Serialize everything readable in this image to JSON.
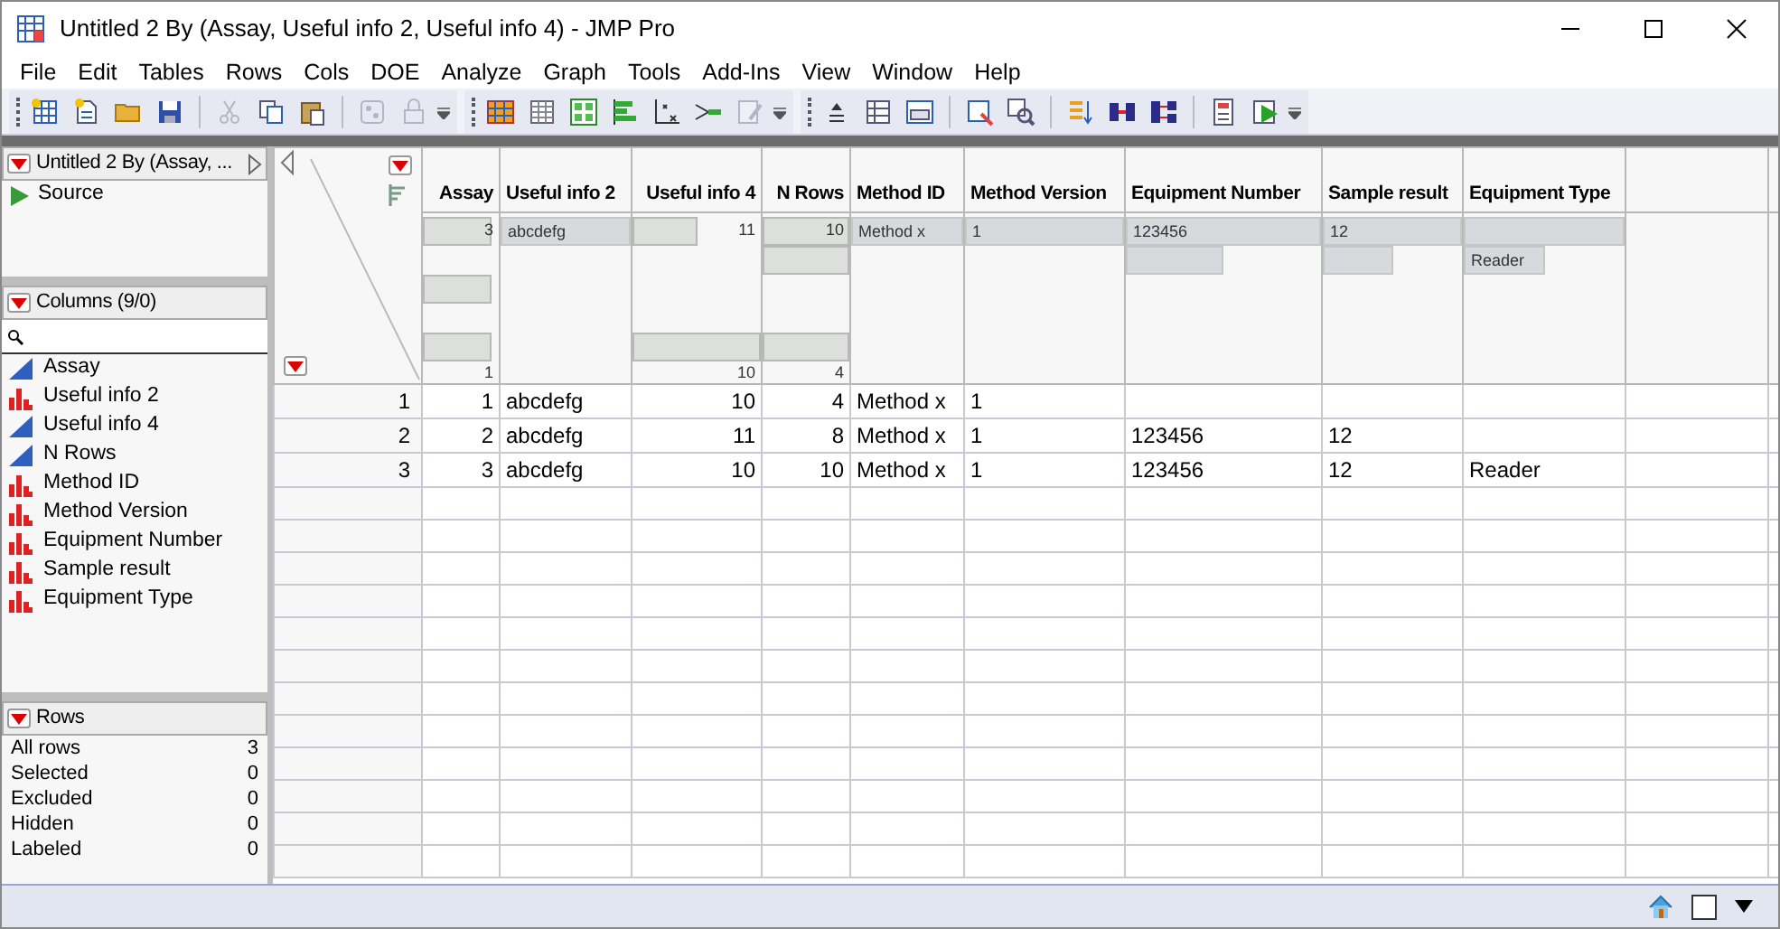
{
  "window": {
    "title": "Untitled 2 By (Assay, Useful info 2, Useful info 4) - JMP Pro"
  },
  "menu": [
    "File",
    "Edit",
    "Tables",
    "Rows",
    "Cols",
    "DOE",
    "Analyze",
    "Graph",
    "Tools",
    "Add-Ins",
    "View",
    "Window",
    "Help"
  ],
  "toolbar": [
    {
      "disabled": false
    },
    {
      "disabled": false
    },
    {
      "disabled": false
    },
    {
      "disabled": false
    },
    {
      "disabled": true
    },
    {
      "disabled": false
    },
    {
      "disabled": false
    },
    {
      "disabled": true
    },
    {
      "disabled": true
    },
    {
      "disabled": false
    },
    {
      "disabled": false
    },
    {
      "disabled": false
    },
    {
      "disabled": false
    },
    {
      "disabled": false
    },
    {
      "disabled": false
    },
    {
      "disabled": true
    },
    {
      "disabled": false
    },
    {
      "disabled": false
    },
    {
      "disabled": false
    },
    {
      "disabled": false
    },
    {
      "disabled": false
    },
    {
      "disabled": false
    },
    {
      "disabled": false
    },
    {
      "disabled": false
    },
    {
      "disabled": false
    },
    {
      "disabled": false
    }
  ],
  "table_panel": {
    "title": "Untitled 2 By (Assay, ...",
    "items": [
      "Source"
    ]
  },
  "columns_panel": {
    "title": "Columns (9/0)",
    "columns": [
      {
        "name": "Assay",
        "kind": "continuous"
      },
      {
        "name": "Useful info 2",
        "kind": "nominal"
      },
      {
        "name": "Useful info 4",
        "kind": "continuous"
      },
      {
        "name": "N Rows",
        "kind": "continuous"
      },
      {
        "name": "Method ID",
        "kind": "nominal"
      },
      {
        "name": "Method Version",
        "kind": "nominal"
      },
      {
        "name": "Equipment Number",
        "kind": "nominal"
      },
      {
        "name": "Sample result",
        "kind": "nominal"
      },
      {
        "name": "Equipment Type",
        "kind": "nominal"
      }
    ]
  },
  "rows_panel": {
    "title": "Rows",
    "stats": [
      {
        "label": "All rows",
        "value": "3"
      },
      {
        "label": "Selected",
        "value": "0"
      },
      {
        "label": "Excluded",
        "value": "0"
      },
      {
        "label": "Hidden",
        "value": "0"
      },
      {
        "label": "Labeled",
        "value": "0"
      }
    ]
  },
  "table": {
    "columns": [
      {
        "name": "Assay",
        "kind": "continuous",
        "bins": [
          {
            "level": 0.9
          },
          {
            "level": 0
          },
          {
            "level": 0.9
          },
          {
            "level": 0
          },
          {
            "level": 0.9
          }
        ],
        "max_label": "3",
        "min_label": "1"
      },
      {
        "name": "Useful info 2",
        "kind": "nominal",
        "bars": [
          {
            "level": 1,
            "label": "abcdefg"
          }
        ]
      },
      {
        "name": "Useful info 4",
        "kind": "continuous",
        "bins": [
          {
            "level": 0.5
          },
          {
            "level": 0
          },
          {
            "level": 0
          },
          {
            "level": 0
          },
          {
            "level": 1
          }
        ],
        "max_label": "11",
        "min_label": "10"
      },
      {
        "name": "N Rows",
        "kind": "continuous",
        "bins": [
          {
            "level": 1
          },
          {
            "level": 1
          },
          {
            "level": 0
          },
          {
            "level": 0
          },
          {
            "level": 1
          }
        ],
        "max_label": "10",
        "min_label": "4"
      },
      {
        "name": "Method ID",
        "kind": "nominal",
        "bars": [
          {
            "level": 1,
            "label": "Method x"
          }
        ]
      },
      {
        "name": "Method Version",
        "kind": "nominal",
        "bars": [
          {
            "level": 1,
            "label": "1"
          }
        ]
      },
      {
        "name": "Equipment Number",
        "kind": "nominal",
        "bars": [
          {
            "level": 1,
            "label": "123456"
          },
          {
            "level": 0.5
          }
        ]
      },
      {
        "name": "Sample result",
        "kind": "nominal",
        "bars": [
          {
            "level": 1,
            "label": "12"
          },
          {
            "level": 0.5
          }
        ]
      },
      {
        "name": "Equipment Type",
        "kind": "nominal",
        "bars": [
          {
            "level": 1
          },
          {
            "level": 0.5,
            "label": "Reader"
          }
        ]
      }
    ],
    "rows": [
      {
        "number": "1",
        "cells": [
          "1",
          "abcdefg",
          "10",
          "4",
          "Method x",
          "1",
          null,
          null,
          null
        ]
      },
      {
        "number": "2",
        "cells": [
          "2",
          "abcdefg",
          "11",
          "8",
          "Method x",
          "1",
          "123456",
          "12",
          null
        ]
      },
      {
        "number": "3",
        "cells": [
          "3",
          "abcdefg",
          "10",
          "10",
          "Method x",
          "1",
          "123456",
          "12",
          "Reader"
        ]
      }
    ]
  }
}
